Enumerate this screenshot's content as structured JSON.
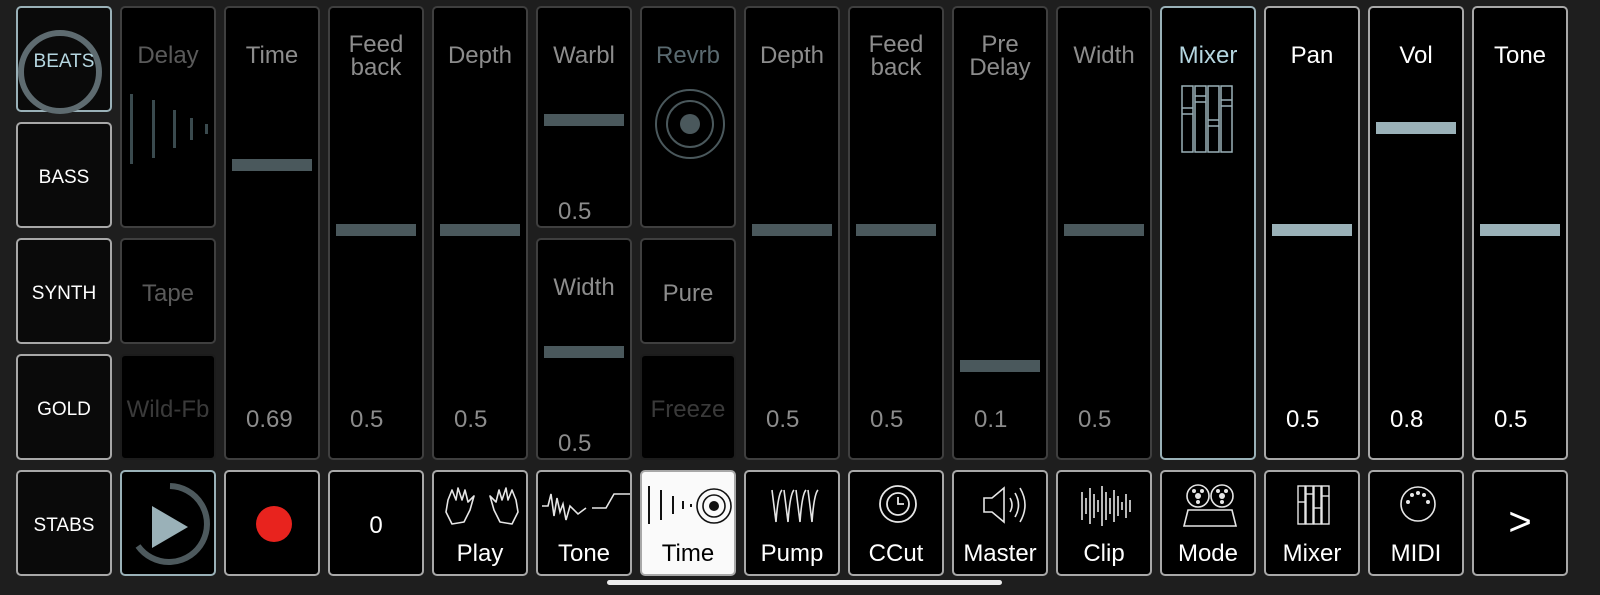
{
  "sidebar": {
    "items": [
      {
        "label": "BEATS",
        "active": true
      },
      {
        "label": "BASS"
      },
      {
        "label": "SYNTH"
      },
      {
        "label": "GOLD"
      },
      {
        "label": "STABS"
      }
    ]
  },
  "effects": {
    "delay": {
      "label": "Delay",
      "icon": "delay-waveform-icon"
    },
    "tape": {
      "label": "Tape"
    },
    "wild_fb": {
      "label": "Wild-Fb"
    },
    "time": {
      "label": "Time",
      "value": "0.69",
      "level": 0.69
    },
    "feedback_1": {
      "label_line1": "Feed",
      "label_line2": "back",
      "value": "0.5",
      "level": 0.5
    },
    "depth_1": {
      "label": "Depth",
      "value": "0.5",
      "level": 0.5
    },
    "warbl": {
      "label": "Warbl",
      "value": "0.5",
      "level": 0.5
    },
    "width_1": {
      "label": "Width",
      "value": "0.5",
      "level": 0.5
    },
    "revrb": {
      "label": "Revrb",
      "icon": "reverb-target-icon"
    },
    "pure": {
      "label": "Pure"
    },
    "freeze": {
      "label": "Freeze"
    },
    "depth_2": {
      "label": "Depth",
      "value": "0.5",
      "level": 0.5
    },
    "feedback_2": {
      "label_line1": "Feed",
      "label_line2": "back",
      "value": "0.5",
      "level": 0.5
    },
    "pre_delay": {
      "label_line1": "Pre",
      "label_line2": "Delay",
      "value": "0.1",
      "level": 0.1
    },
    "width_2": {
      "label": "Width",
      "value": "0.5",
      "level": 0.5
    }
  },
  "mixer": {
    "header": {
      "label": "Mixer",
      "icon": "mixer-faders-icon"
    },
    "pan": {
      "label": "Pan",
      "value": "0.5",
      "level": 0.5
    },
    "vol": {
      "label": "Vol",
      "value": "0.8",
      "level": 0.8
    },
    "tone": {
      "label": "Tone",
      "value": "0.5",
      "level": 0.5
    }
  },
  "transport": {
    "play_icon": "play-icon",
    "record_icon": "record-icon",
    "counter": "0"
  },
  "pages": [
    {
      "label": "Play",
      "icon": "hands-icon"
    },
    {
      "label": "Tone",
      "icon": "filter-wave-icon"
    },
    {
      "label": "Time",
      "icon": "delay-reverb-icon",
      "selected": true
    },
    {
      "label": "Pump",
      "icon": "pump-envelope-icon"
    },
    {
      "label": "CCut",
      "icon": "ccut-knob-icon"
    },
    {
      "label": "Master",
      "icon": "speaker-icon"
    },
    {
      "label": "Clip",
      "icon": "clip-waveform-icon"
    },
    {
      "label": "Mode",
      "icon": "tape-reels-icon"
    },
    {
      "label": "Mixer",
      "icon": "mixer-faders-icon"
    },
    {
      "label": "MIDI",
      "icon": "midi-port-icon"
    }
  ],
  "next_button": {
    "label": ">"
  },
  "colors": {
    "accent": "#9ab1b8",
    "record": "#e8231e",
    "play": "#9ab1b8"
  }
}
